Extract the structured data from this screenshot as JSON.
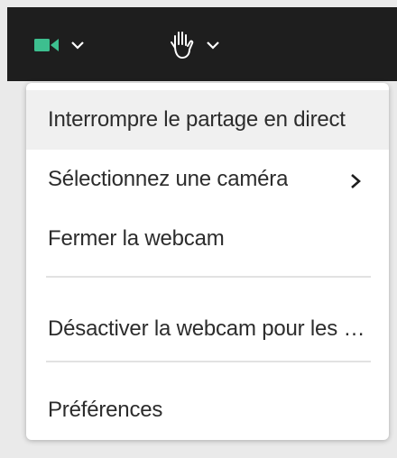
{
  "toolbar": {
    "camera_button": {
      "icon": "video-camera-icon",
      "icon_color": "#3dbf8f"
    },
    "hand_button": {
      "icon": "raise-hand-icon"
    }
  },
  "menu": {
    "stop_sharing_label": "Interrompre le partage en direct",
    "select_camera_label": "Sélectionnez une caméra",
    "close_webcam_label": "Fermer la webcam",
    "disable_webcam_label": "Désactiver la webcam pour les pa...",
    "preferences_label": "Préférences"
  }
}
